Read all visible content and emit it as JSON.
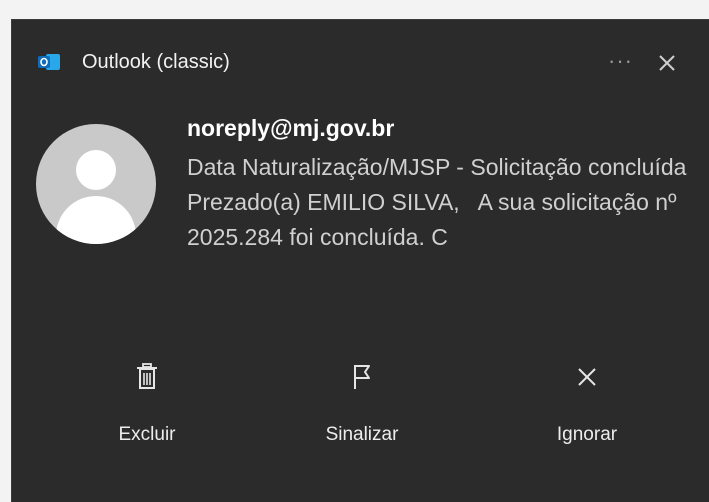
{
  "app": {
    "name": "Outlook (classic)",
    "icon": "outlook-icon",
    "accent": "#0f6cbd"
  },
  "header": {
    "more_label": "···",
    "close_icon": "close-icon"
  },
  "message": {
    "sender": "noreply@mj.gov.br",
    "subject": "Data Naturalização/MJSP - Solicitação concluída",
    "preview": "Prezado(a) EMILIO SILVA,   A sua solicitação nº 2025.284 foi concluída. C"
  },
  "actions": [
    {
      "label": "Excluir",
      "icon": "trash-icon"
    },
    {
      "label": "Sinalizar",
      "icon": "flag-icon"
    },
    {
      "label": "Ignorar",
      "icon": "dismiss-icon"
    }
  ],
  "colors": {
    "toast_bg": "#2b2b2b",
    "text_primary": "#ffffff",
    "text_secondary": "#d0d0d0"
  }
}
